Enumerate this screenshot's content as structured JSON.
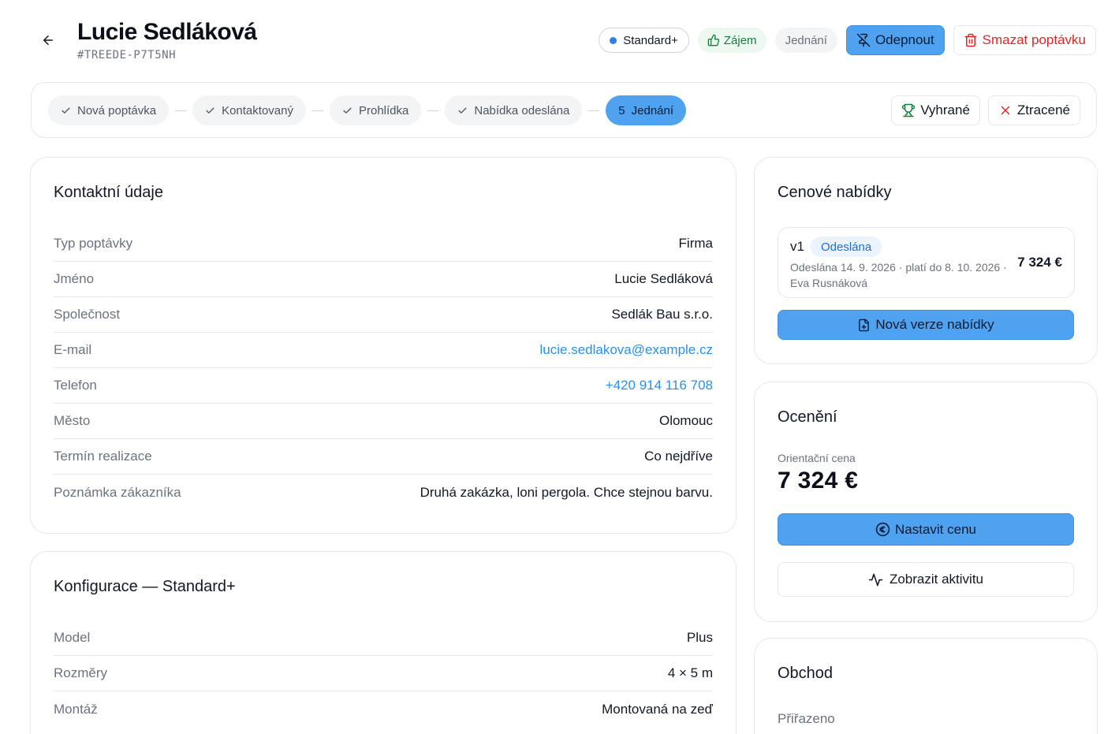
{
  "header": {
    "title": "Lucie Sedláková",
    "id": "#TREEDE-P7T5NH",
    "badges": {
      "variant": "Standard+",
      "interest": "Zájem",
      "stage": "Jednání"
    },
    "unpin_label": "Odepnout",
    "delete_label": "Smazat poptávku"
  },
  "pipeline": {
    "steps": [
      {
        "label": "Nová poptávka",
        "done": true
      },
      {
        "label": "Kontaktovaný",
        "done": true
      },
      {
        "label": "Prohlídka",
        "done": true
      },
      {
        "label": "Nabídka odeslána",
        "done": true
      },
      {
        "label": "Jednání",
        "number": "5",
        "active": true
      }
    ],
    "won_label": "Vyhrané",
    "lost_label": "Ztracené"
  },
  "contact": {
    "title": "Kontaktní údaje",
    "rows": [
      {
        "label": "Typ poptávky",
        "value": "Firma"
      },
      {
        "label": "Jméno",
        "value": "Lucie Sedláková"
      },
      {
        "label": "Společnost",
        "value": "Sedlák Bau s.r.o."
      },
      {
        "label": "E-mail",
        "value": "lucie.sedlakova@example.cz"
      },
      {
        "label": "Telefon",
        "value": "+420 914 116 708"
      },
      {
        "label": "Město",
        "value": "Olomouc"
      },
      {
        "label": "Termín realizace",
        "value": "Co nejdříve"
      },
      {
        "label": "Poznámka zákazníka",
        "value": "Druhá zakázka, loni pergola. Chce stejnou barvu."
      }
    ]
  },
  "config": {
    "title": "Konfigurace — Standard+",
    "rows": [
      {
        "label": "Model",
        "value": "Plus"
      },
      {
        "label": "Rozměry",
        "value": "4 × 5 m"
      },
      {
        "label": "Montáž",
        "value": "Montovaná na zeď"
      }
    ]
  },
  "offers": {
    "title": "Cenové nabídky",
    "item": {
      "version": "v1",
      "status": "Odeslána",
      "meta": "Odeslána 14. 9. 2026 · platí do 8. 10. 2026 · Eva Rusnáková",
      "price": "7 324 €"
    },
    "new_version_label": "Nová verze nabídky"
  },
  "pricing": {
    "title": "Ocenění",
    "price_label": "Orientační cena",
    "price_value": "7 324 €",
    "set_price_label": "Nastavit cenu",
    "activity_label": "Zobrazit aktivitu"
  },
  "deal": {
    "title": "Obchod",
    "assigned_label": "Přiřazeno"
  },
  "colors": {
    "accent": "#4ea2f0",
    "link": "#2b8fe8",
    "danger": "#dc2626",
    "success": "#15803d"
  },
  "icons": {
    "back": "arrow-left-icon",
    "thumb": "thumbs-up-icon",
    "unpin": "pin-off-icon",
    "trash": "trash-icon",
    "check": "check-icon",
    "trophy": "trophy-icon",
    "close": "x-icon",
    "doc": "file-plus-icon",
    "euro": "euro-circle-icon",
    "activity": "activity-icon"
  }
}
